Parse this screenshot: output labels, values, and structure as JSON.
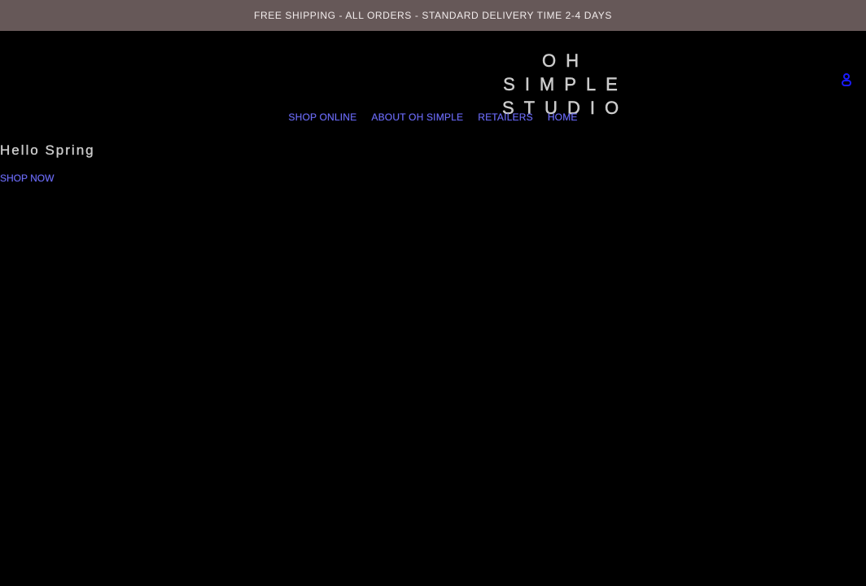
{
  "announcement": {
    "text": "FREE SHIPPING - ALL ORDERS - STANDARD DELIVERY TIME 2-4 DAYS"
  },
  "header": {
    "logo_line1": "OH SIMPLE",
    "logo_line2": "STUDIO",
    "account_icon": "user-icon",
    "accent_color": "#1a1aff"
  },
  "nav": {
    "items": [
      {
        "label": "SHOP ONLINE"
      },
      {
        "label": "ABOUT OH SIMPLE"
      },
      {
        "label": "RETAILERS"
      },
      {
        "label": "HOME"
      }
    ]
  },
  "hero": {
    "title": "Hello Spring",
    "cta": "SHOP NOW"
  }
}
